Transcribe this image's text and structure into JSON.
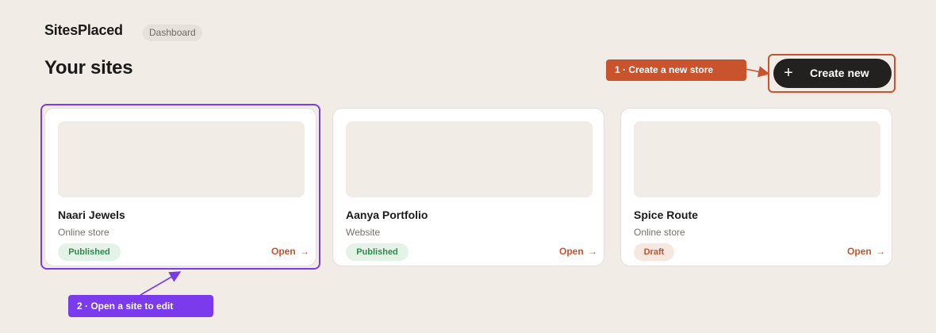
{
  "header": {
    "brand": "SitesPlaced",
    "breadcrumb": "Dashboard",
    "title": "Your sites"
  },
  "actions": {
    "create_label": "Create new",
    "create_icon": "plus-icon"
  },
  "annotations": {
    "step1": "1 · Create a new store",
    "step2": "2 · Open a site to edit"
  },
  "sites": [
    {
      "name": "Naari Jewels",
      "type": "Online store",
      "status": "Published",
      "open_label": "Open",
      "open_arrow": "→"
    },
    {
      "name": "Aanya Portfolio",
      "type": "Website",
      "status": "Published",
      "open_label": "Open",
      "open_arrow": "→"
    },
    {
      "name": "Spice Route",
      "type": "Online store",
      "status": "Draft",
      "open_label": "Open",
      "open_arrow": "→"
    }
  ],
  "colors": {
    "background": "#f1ece6",
    "accent": "#c9532c",
    "annotation_purple": "#7c3aed",
    "button_dark": "#232120",
    "published_bg": "#e5f2e8",
    "published_text": "#2d8a4b",
    "draft_bg": "#f7e8df",
    "draft_text": "#bf5330"
  }
}
